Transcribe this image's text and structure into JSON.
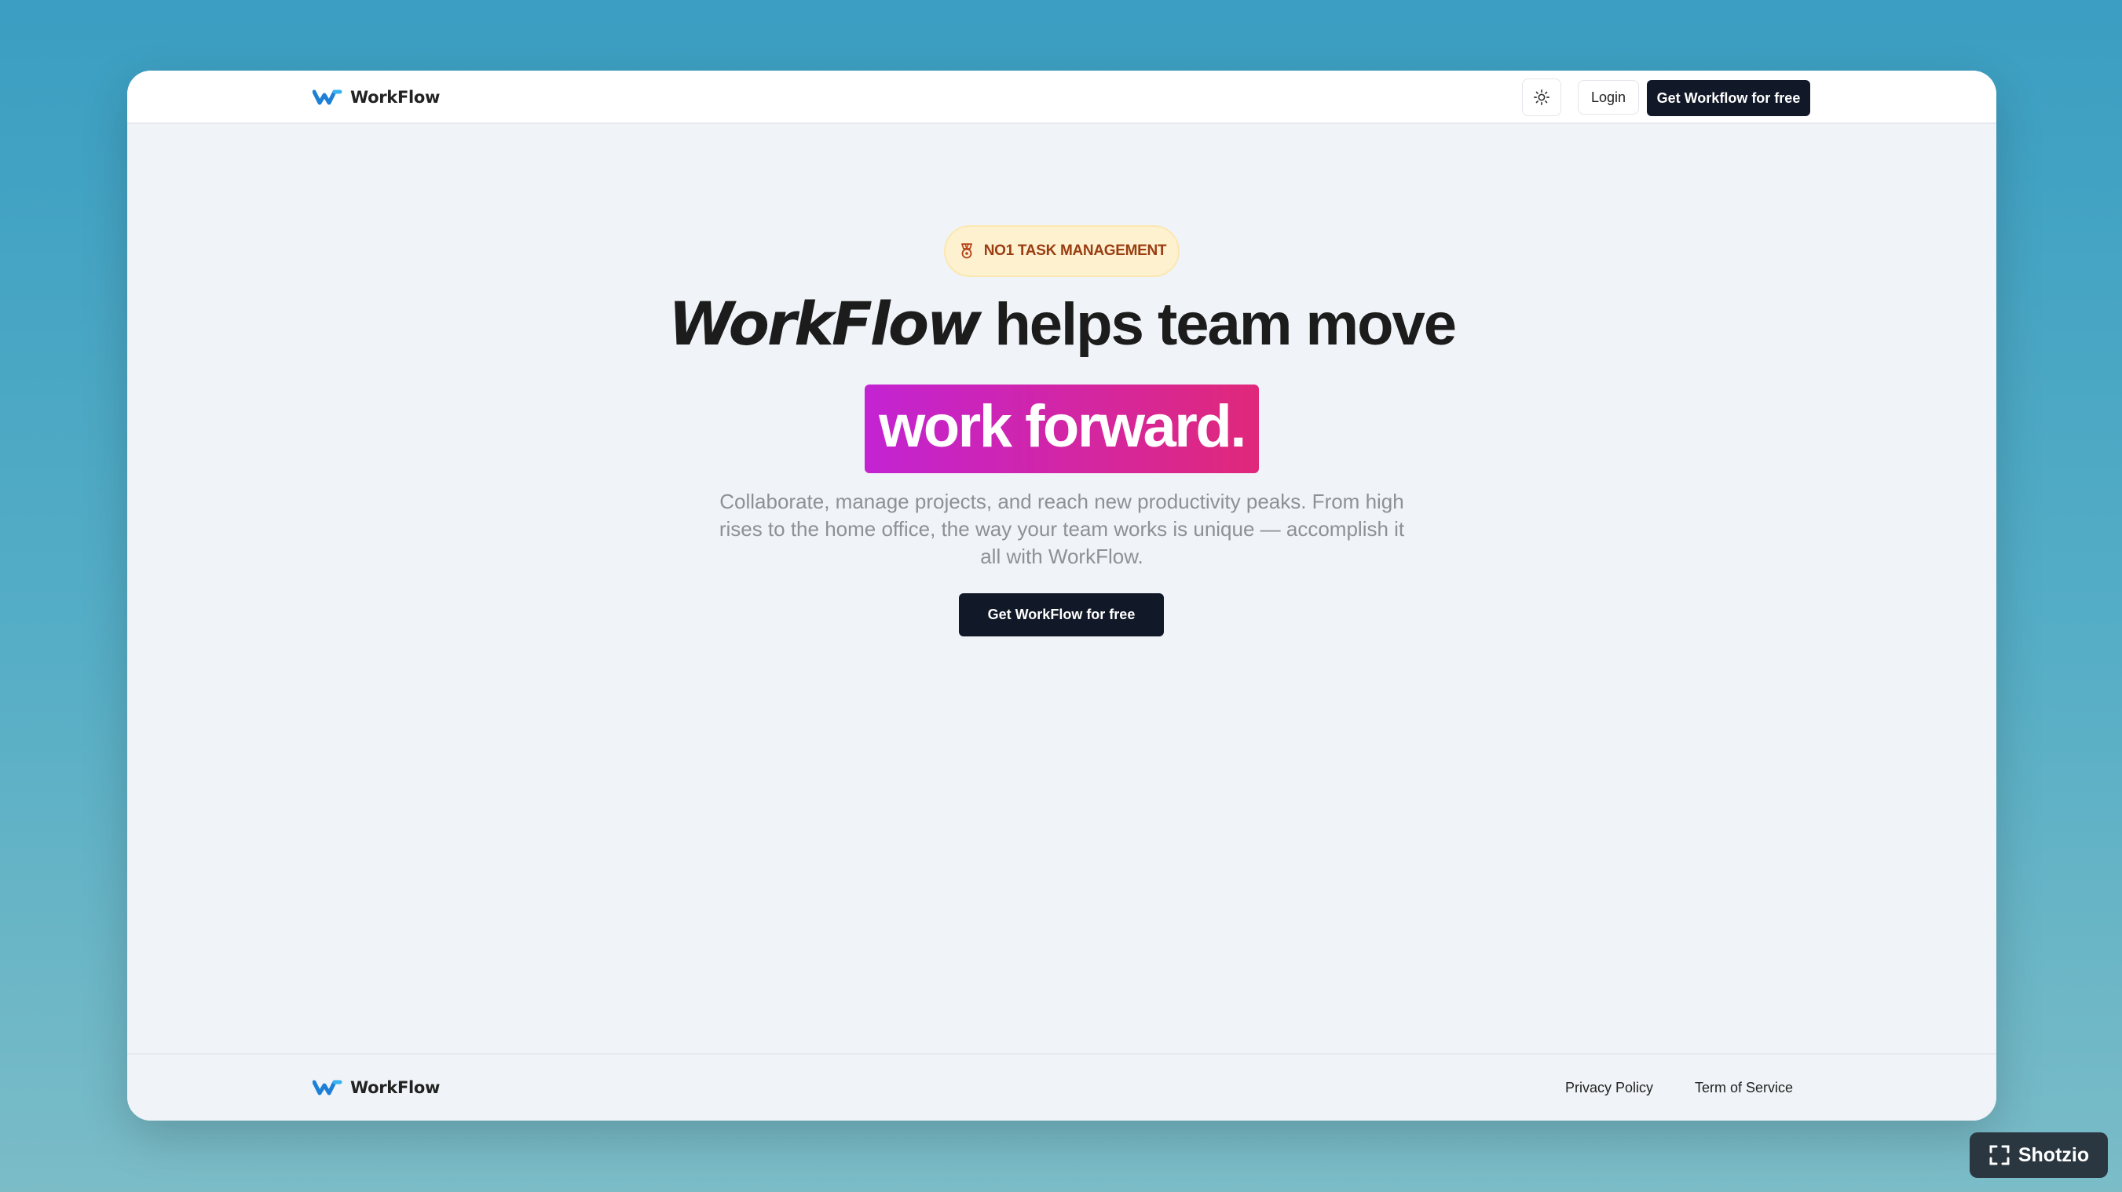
{
  "app": {
    "brand_name": "WorkFlow",
    "brand_color": "#2a8fe0",
    "accent_dark": "#111827"
  },
  "header": {
    "theme_toggle_icon": "sun-icon",
    "login_label": "Login",
    "cta_label": "Get Workflow for free"
  },
  "hero": {
    "badge_icon": "award-badge-icon",
    "badge_text": "NO1 TASK MANAGEMENT",
    "headline_brand": "WorkFlow",
    "headline_rest": " helps team move",
    "highlight_text": "work forward.",
    "highlight_gradient": [
      "#c323d3",
      "#e0287a"
    ],
    "description": "Collaborate, manage projects, and reach new productivity peaks. From high rises to the home office, the way your team works is unique — accomplish it all with WorkFlow.",
    "cta_label": "Get WorkFlow for free"
  },
  "footer": {
    "brand_name": "WorkFlow",
    "links": [
      "Privacy Policy",
      "Term of Service"
    ]
  },
  "watermark": {
    "icon": "fullscreen-corners-icon",
    "label": "Shotzio"
  }
}
